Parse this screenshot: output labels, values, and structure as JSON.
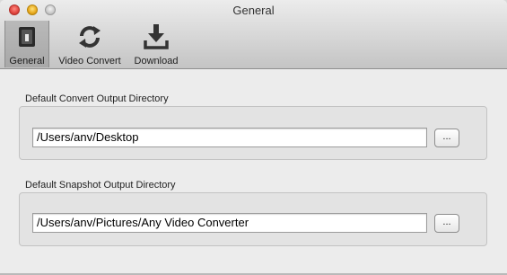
{
  "window": {
    "title": "General"
  },
  "toolbar": {
    "items": [
      {
        "label": "General",
        "icon": "general-switch-icon",
        "selected": true
      },
      {
        "label": "Video Convert",
        "icon": "refresh-icon",
        "selected": false
      },
      {
        "label": "Download",
        "icon": "download-icon",
        "selected": false
      }
    ]
  },
  "convert_section": {
    "label": "Default Convert Output Directory",
    "path_value": "/Users/anv/Desktop",
    "browse_label": "..."
  },
  "snapshot_section": {
    "label": "Default Snapshot Output Directory",
    "path_value": "/Users/anv/Pictures/Any Video Converter",
    "browse_label": "..."
  },
  "colors": {
    "background": "#ececec",
    "group_box": "#e3e3e3",
    "selected_toolbar": "#aeaeae"
  }
}
